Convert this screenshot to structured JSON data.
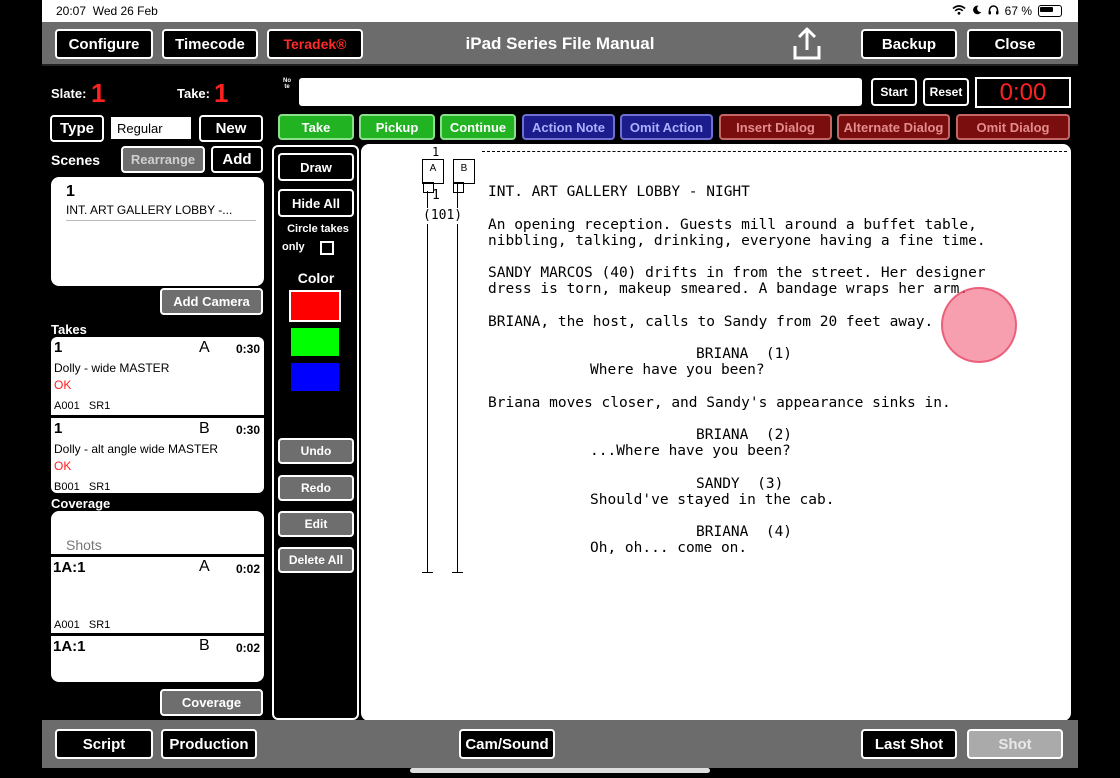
{
  "status_bar": {
    "time": "20:07",
    "date": "Wed 26 Feb",
    "battery": "67 %"
  },
  "header": {
    "title": "iPad Series File Manual",
    "configure": "Configure",
    "timecode": "Timecode",
    "teradek": "Teradek®",
    "backup": "Backup",
    "close": "Close"
  },
  "slate": {
    "slate_label": "Slate:",
    "slate_value": "1",
    "take_label": "Take:",
    "take_value": "1"
  },
  "note": {
    "vertical_label": "Note",
    "value": "",
    "start": "Start",
    "reset": "Reset",
    "timer": "0:00"
  },
  "type_row": {
    "type": "Type",
    "value": "Regular",
    "new": "New"
  },
  "scenes": {
    "label": "Scenes",
    "rearrange": "Rearrange",
    "add": "Add",
    "items": [
      {
        "number": "1",
        "title": "INT. ART GALLERY LOBBY -..."
      }
    ],
    "add_camera": "Add Camera"
  },
  "actions": {
    "take": "Take",
    "pickup": "Pickup",
    "continue": "Continue",
    "action_note": "Action Note",
    "omit_action": "Omit Action",
    "insert_dialog": "Insert Dialog",
    "alternate_dialog": "Alternate Dialog",
    "omit_dialog": "Omit Dialog"
  },
  "takes": {
    "label": "Takes",
    "items": [
      {
        "number": "1",
        "cam": "A",
        "duration": "0:30",
        "desc": "Dolly - wide MASTER",
        "status": "OK",
        "roll": "A001   SR1"
      },
      {
        "number": "1",
        "cam": "B",
        "duration": "0:30",
        "desc": "Dolly - alt angle wide MASTER",
        "status": "OK",
        "roll": "B001   SR1"
      }
    ]
  },
  "coverage": {
    "label": "Coverage",
    "shots_label": "Shots",
    "items": [
      {
        "shot": "1A:1",
        "cam": "A",
        "duration": "0:02",
        "roll": "A001   SR1"
      },
      {
        "shot": "1A:1",
        "cam": "B",
        "duration": "0:02",
        "roll": ""
      }
    ],
    "button": "Coverage"
  },
  "tools": {
    "draw": "Draw",
    "hide_all": "Hide All",
    "circle_takes_line1": "Circle takes",
    "circle_takes_line2": "only",
    "color_label": "Color",
    "colors": [
      "#ff0000",
      "#00ff00",
      "#0000ff"
    ],
    "undo": "Undo",
    "redo": "Redo",
    "edit": "Edit",
    "delete_all": "Delete All"
  },
  "script": {
    "scene_number_top": "1",
    "scene_number_side": "1",
    "scene_paren": "(101)",
    "cam_a": "A",
    "cam_b": "B",
    "heading": "INT. ART GALLERY LOBBY - NIGHT",
    "p1a": "An opening reception. Guests mill around a buffet table,",
    "p1b": "nibbling, talking, drinking, everyone having a fine time.",
    "p2a": "SANDY MARCOS (40) drifts in from the street. Her designer",
    "p2b": "dress is torn, makeup smeared. A bandage wraps her arm.",
    "p3": "BRIANA, the host, calls to Sandy from 20 feet away.",
    "c1": "BRIANA  (1)",
    "d1": "Where have you been?",
    "p4": "Briana moves closer, and Sandy's appearance sinks in.",
    "c2": "BRIANA  (2)",
    "d2": "...Where have you been?",
    "c3": "SANDY  (3)",
    "d3": "Should've stayed in the cab.",
    "c4": "BRIANA  (4)",
    "d4": "Oh, oh... come on."
  },
  "bottom": {
    "script": "Script",
    "production": "Production",
    "cam_sound": "Cam/Sound",
    "last_shot": "Last Shot",
    "shot": "Shot"
  }
}
